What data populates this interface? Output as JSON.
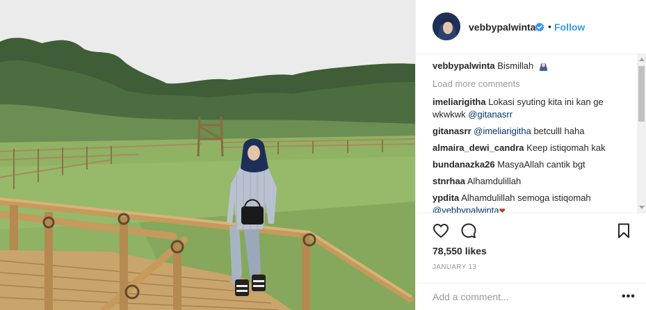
{
  "post": {
    "image_alt": "",
    "header": {
      "username": "vebbypalwinta",
      "separator": "•",
      "follow_label": "Follow"
    },
    "caption": {
      "username": "vebbypalwinta",
      "text": "Bismillah"
    },
    "load_more": "Load more comments",
    "comments": [
      {
        "username": "imeliarigitha",
        "text": "Lokasi syuting kita ini kan ge wkwkwk",
        "mention": "@gitanasrr"
      },
      {
        "username": "gitanasrr",
        "mention": "@imeliarigitha",
        "text": "betculll haha"
      },
      {
        "username": "almaira_dewi_candra",
        "text": "Keep istiqomah kak"
      },
      {
        "username": "bundanazka26",
        "text": "MasyaAllah cantik bgt"
      },
      {
        "username": "stnrhaa",
        "text": "Alhamdulillah"
      },
      {
        "username": "ypdita",
        "text": "Alhamdulillah semoga istiqomah",
        "mention": "@vebbypalwinta"
      }
    ],
    "likes": "78,550 likes",
    "date": "JANUARY 13",
    "comment_placeholder": "Add a comment...",
    "more_label": "•••",
    "icons": {
      "like": "heart-icon",
      "comment": "comment-bubble-icon",
      "save": "bookmark-icon",
      "verified": "verified-badge-icon"
    },
    "colors": {
      "link_blue": "#3897f0",
      "mention_blue": "#003569",
      "muted": "#999999",
      "text": "#262626"
    }
  }
}
